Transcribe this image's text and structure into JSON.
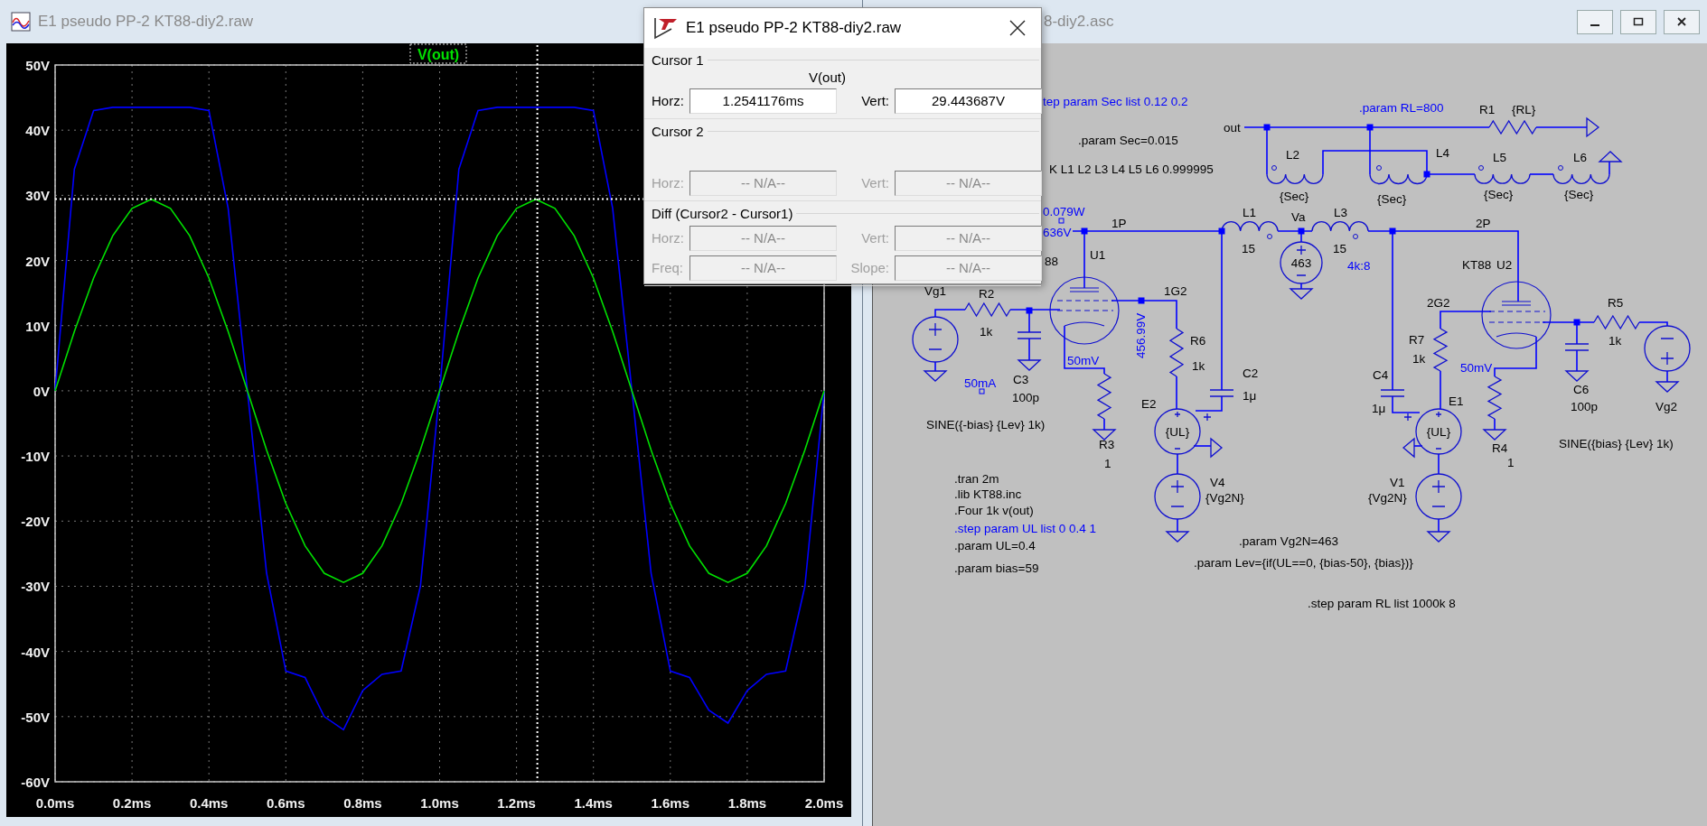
{
  "plot_window": {
    "title": "E1 pseudo PP-2 KT88-diy2.raw",
    "chart_data": {
      "type": "line",
      "title": "V(out)",
      "xlim": [
        0,
        2
      ],
      "ylim": [
        -60,
        50
      ],
      "x": [
        0,
        0.05,
        0.1,
        0.15,
        0.2,
        0.25,
        0.3,
        0.35,
        0.4,
        0.45,
        0.5,
        0.55,
        0.6,
        0.65,
        0.7,
        0.75,
        0.8,
        0.85,
        0.9,
        0.95,
        1,
        1.05,
        1.1,
        1.15,
        1.2,
        1.25,
        1.3,
        1.35,
        1.4,
        1.45,
        1.5,
        1.55,
        1.6,
        1.65,
        1.7,
        1.75,
        1.8,
        1.85,
        1.9,
        1.95,
        2
      ],
      "series": [
        {
          "color": "#0000ff",
          "values": [
            0,
            34,
            43,
            43.5,
            43.5,
            43.5,
            43.5,
            43.5,
            43,
            28,
            0,
            -28,
            -43,
            -44,
            -50,
            -52,
            -46,
            -43.5,
            -43,
            -30,
            0,
            34,
            43,
            43.5,
            43.5,
            43.5,
            43.5,
            43.5,
            43,
            28,
            0,
            -28,
            -43,
            -44,
            -49,
            -51,
            -46,
            -43.5,
            -43,
            -30,
            0
          ]
        },
        {
          "color": "#00e000",
          "values": [
            0,
            9.1,
            17.3,
            23.8,
            28,
            29.4,
            28,
            23.8,
            17.3,
            9.1,
            0,
            -9.1,
            -17.3,
            -23.8,
            -28,
            -29.4,
            -28,
            -23.8,
            -17.3,
            -9.1,
            0,
            9.1,
            17.3,
            23.8,
            28,
            29.4,
            28,
            23.8,
            17.3,
            9.1,
            0,
            -9.1,
            -17.3,
            -23.8,
            -28,
            -29.4,
            -28,
            -23.8,
            -17.3,
            -9.1,
            0
          ]
        }
      ],
      "xticks": [
        {
          "value": 0,
          "label": "0.0ms"
        },
        {
          "value": 0.2,
          "label": "0.2ms"
        },
        {
          "value": 0.4,
          "label": "0.4ms"
        },
        {
          "value": 0.6,
          "label": "0.6ms"
        },
        {
          "value": 0.8,
          "label": "0.8ms"
        },
        {
          "value": 1,
          "label": "1.0ms"
        },
        {
          "value": 1.2,
          "label": "1.2ms"
        },
        {
          "value": 1.4,
          "label": "1.4ms"
        },
        {
          "value": 1.6,
          "label": "1.6ms"
        },
        {
          "value": 1.8,
          "label": "1.8ms"
        },
        {
          "value": 2,
          "label": "2.0ms"
        }
      ],
      "yticks": [
        {
          "value": 50,
          "label": "50V"
        },
        {
          "value": 40,
          "label": "40V"
        },
        {
          "value": 30,
          "label": "30V"
        },
        {
          "value": 20,
          "label": "20V"
        },
        {
          "value": 10,
          "label": "10V"
        },
        {
          "value": 0,
          "label": "0V"
        },
        {
          "value": -10,
          "label": "-10V"
        },
        {
          "value": -20,
          "label": "-20V"
        },
        {
          "value": -30,
          "label": "-30V"
        },
        {
          "value": -40,
          "label": "-40V"
        },
        {
          "value": -50,
          "label": "-50V"
        },
        {
          "value": -60,
          "label": "-60V"
        }
      ],
      "grid": true,
      "ref_lines": [
        {
          "axis": "x",
          "value": 1.2541176
        },
        {
          "axis": "y",
          "value": 29.443687
        }
      ]
    }
  },
  "cursor_dialog": {
    "title": "E1 pseudo PP-2 KT88-diy2.raw",
    "groups": [
      {
        "label": "Cursor 1",
        "trace": "V(out)",
        "rows": [
          [
            {
              "label": "Horz:",
              "value": "1.2541176ms",
              "disabled": false
            },
            {
              "label": "Vert:",
              "value": "29.443687V",
              "disabled": false
            }
          ]
        ]
      },
      {
        "label": "Cursor 2",
        "rows": [
          [
            {
              "label": "Horz:",
              "value": "-- N/A--",
              "disabled": true
            },
            {
              "label": "Vert:",
              "value": "-- N/A--",
              "disabled": true
            }
          ]
        ]
      },
      {
        "label": "Diff (Cursor2 - Cursor1)",
        "rows": [
          [
            {
              "label": "Horz:",
              "value": "-- N/A--",
              "disabled": true
            },
            {
              "label": "Vert:",
              "value": "-- N/A--",
              "disabled": true
            }
          ],
          [
            {
              "label": "Freq:",
              "value": "-- N/A--",
              "disabled": true
            },
            {
              "label": "Slope:",
              "value": "-- N/A--",
              "disabled": true
            }
          ]
        ]
      }
    ]
  },
  "schematic_window": {
    "title": "8-diy2.asc",
    "labels": [
      {
        "text": "tep param Sec list 0.12 0.2",
        "kind": "directive"
      },
      {
        "text": ".param RL=800",
        "kind": "directive"
      },
      {
        "text": "R1",
        "kind": "label"
      },
      {
        "text": "{RL}",
        "kind": "label"
      },
      {
        "text": "out",
        "kind": "label"
      },
      {
        "text": ".param Sec=0.015",
        "kind": "label"
      },
      {
        "text": "K L1 L2  L3 L4 L5 L6 0.999995",
        "kind": "label"
      },
      {
        "text": "L2",
        "kind": "label"
      },
      {
        "text": "L4",
        "kind": "label"
      },
      {
        "text": "L5",
        "kind": "label"
      },
      {
        "text": "L6",
        "kind": "label"
      },
      {
        "text": "{Sec}",
        "kind": "label"
      },
      {
        "text": "{Sec}",
        "kind": "label"
      },
      {
        "text": "{Sec}",
        "kind": "label"
      },
      {
        "text": "{Sec}",
        "kind": "label"
      },
      {
        "text": "0.079W",
        "kind": "probe"
      },
      {
        "text": "636V",
        "kind": "probe"
      },
      {
        "text": "1P",
        "kind": "label"
      },
      {
        "text": "L1",
        "kind": "label"
      },
      {
        "text": "Va",
        "kind": "label"
      },
      {
        "text": "L3",
        "kind": "label"
      },
      {
        "text": "2P",
        "kind": "label"
      },
      {
        "text": "15",
        "kind": "label"
      },
      {
        "text": "15",
        "kind": "label"
      },
      {
        "text": "463",
        "kind": "label"
      },
      {
        "text": "4k:8",
        "kind": "directive"
      },
      {
        "text": "88",
        "kind": "label"
      },
      {
        "text": "U1",
        "kind": "label"
      },
      {
        "text": "KT88",
        "kind": "label"
      },
      {
        "text": "U2",
        "kind": "label"
      },
      {
        "text": "Vg1",
        "kind": "label"
      },
      {
        "text": "R2",
        "kind": "label"
      },
      {
        "text": "1G2",
        "kind": "label"
      },
      {
        "text": "2G2",
        "kind": "label"
      },
      {
        "text": "R5",
        "kind": "label"
      },
      {
        "text": "1k",
        "kind": "label"
      },
      {
        "text": "456.99V",
        "kind": "probe"
      },
      {
        "text": "R6",
        "kind": "label"
      },
      {
        "text": "1k",
        "kind": "label"
      },
      {
        "text": "R7",
        "kind": "label"
      },
      {
        "text": "1k",
        "kind": "label"
      },
      {
        "text": "1k",
        "kind": "label"
      },
      {
        "text": "50mV",
        "kind": "probe"
      },
      {
        "text": "50mV",
        "kind": "probe"
      },
      {
        "text": "50mA",
        "kind": "probe"
      },
      {
        "text": "C3",
        "kind": "label"
      },
      {
        "text": "C2",
        "kind": "label"
      },
      {
        "text": "C4",
        "kind": "label"
      },
      {
        "text": "C6",
        "kind": "label"
      },
      {
        "text": "100p",
        "kind": "label"
      },
      {
        "text": "E2",
        "kind": "label"
      },
      {
        "text": "1μ",
        "kind": "label"
      },
      {
        "text": "1μ",
        "kind": "label"
      },
      {
        "text": "E1",
        "kind": "label"
      },
      {
        "text": "100p",
        "kind": "label"
      },
      {
        "text": "Vg2",
        "kind": "label"
      },
      {
        "text": "{UL}",
        "kind": "label"
      },
      {
        "text": "{UL}",
        "kind": "label"
      },
      {
        "text": "SINE({-bias} {Lev} 1k)",
        "kind": "label"
      },
      {
        "text": "R3",
        "kind": "label"
      },
      {
        "text": "R4",
        "kind": "label"
      },
      {
        "text": "SINE({bias} {Lev} 1k)",
        "kind": "label"
      },
      {
        "text": "1",
        "kind": "label"
      },
      {
        "text": "1",
        "kind": "label"
      },
      {
        "text": "V4",
        "kind": "label"
      },
      {
        "text": "V1",
        "kind": "label"
      },
      {
        "text": "{Vg2N}",
        "kind": "label"
      },
      {
        "text": "{Vg2N}",
        "kind": "label"
      },
      {
        "text": ".tran 2m",
        "kind": "label"
      },
      {
        "text": ".lib KT88.inc",
        "kind": "label"
      },
      {
        "text": ".Four 1k v(out)",
        "kind": "label"
      },
      {
        "text": ".step param UL list 0 0.4 1",
        "kind": "directive"
      },
      {
        "text": ".param UL=0.4",
        "kind": "label"
      },
      {
        "text": ".param Vg2N=463",
        "kind": "label"
      },
      {
        "text": ".param bias=59",
        "kind": "label"
      },
      {
        "text": ".param Lev={if(UL==0, {bias-50}, {bias})}",
        "kind": "label"
      },
      {
        "text": ".step param RL list 1000k 8",
        "kind": "label"
      }
    ]
  }
}
